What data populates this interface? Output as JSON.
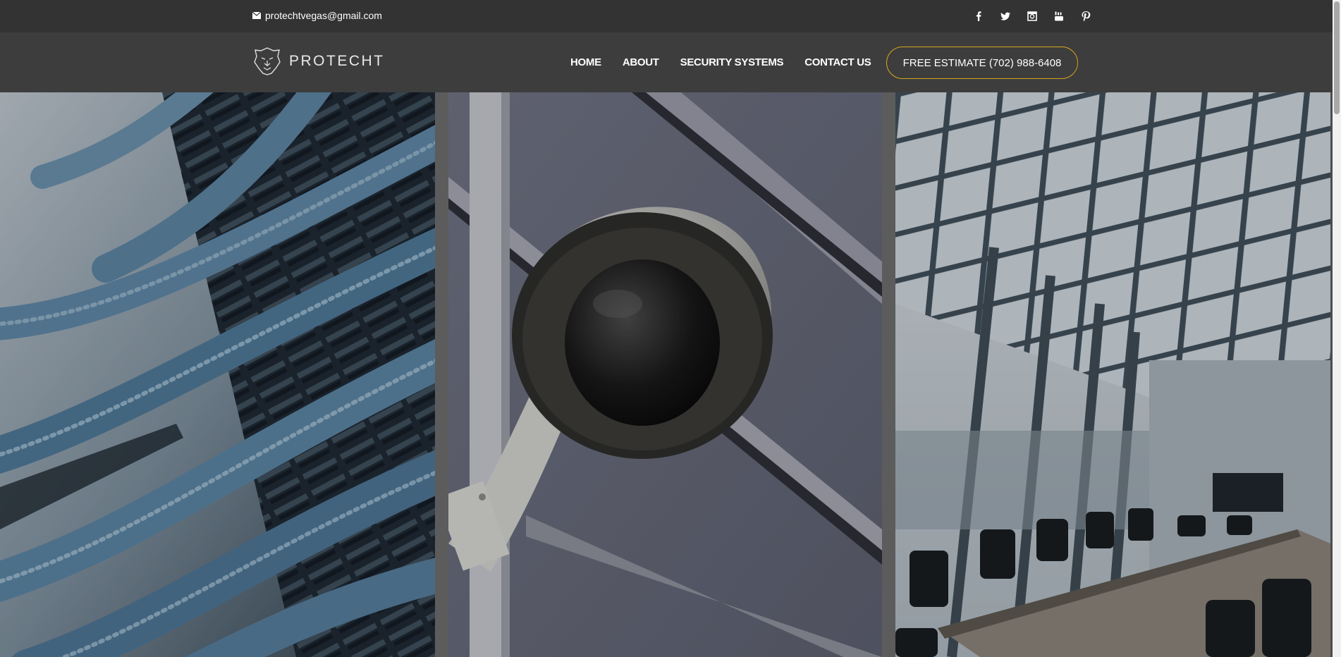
{
  "topbar": {
    "email": "protechtvegas@gmail.com",
    "email_icon": "mail-icon",
    "social_icons": [
      "facebook-icon",
      "twitter-icon",
      "instagram-icon",
      "youtube-icon",
      "pinterest-icon"
    ]
  },
  "header": {
    "logo_text": "PROTECHT",
    "logo_icon": "lion-head-icon",
    "nav": [
      "HOME",
      "ABOUT",
      "SECURITY SYSTEMS",
      "CONTACT US"
    ],
    "cta_label": "FREE ESTIMATE (702) 988-6408"
  },
  "hero": {
    "panels": [
      "server-rack-cables-photo",
      "security-dome-camera-photo",
      "conference-room-photo"
    ]
  },
  "colors": {
    "topbar_bg": "#333333",
    "header_bg": "#3d3d3d",
    "cta_border": "#d4a41f",
    "text": "#ffffff"
  }
}
